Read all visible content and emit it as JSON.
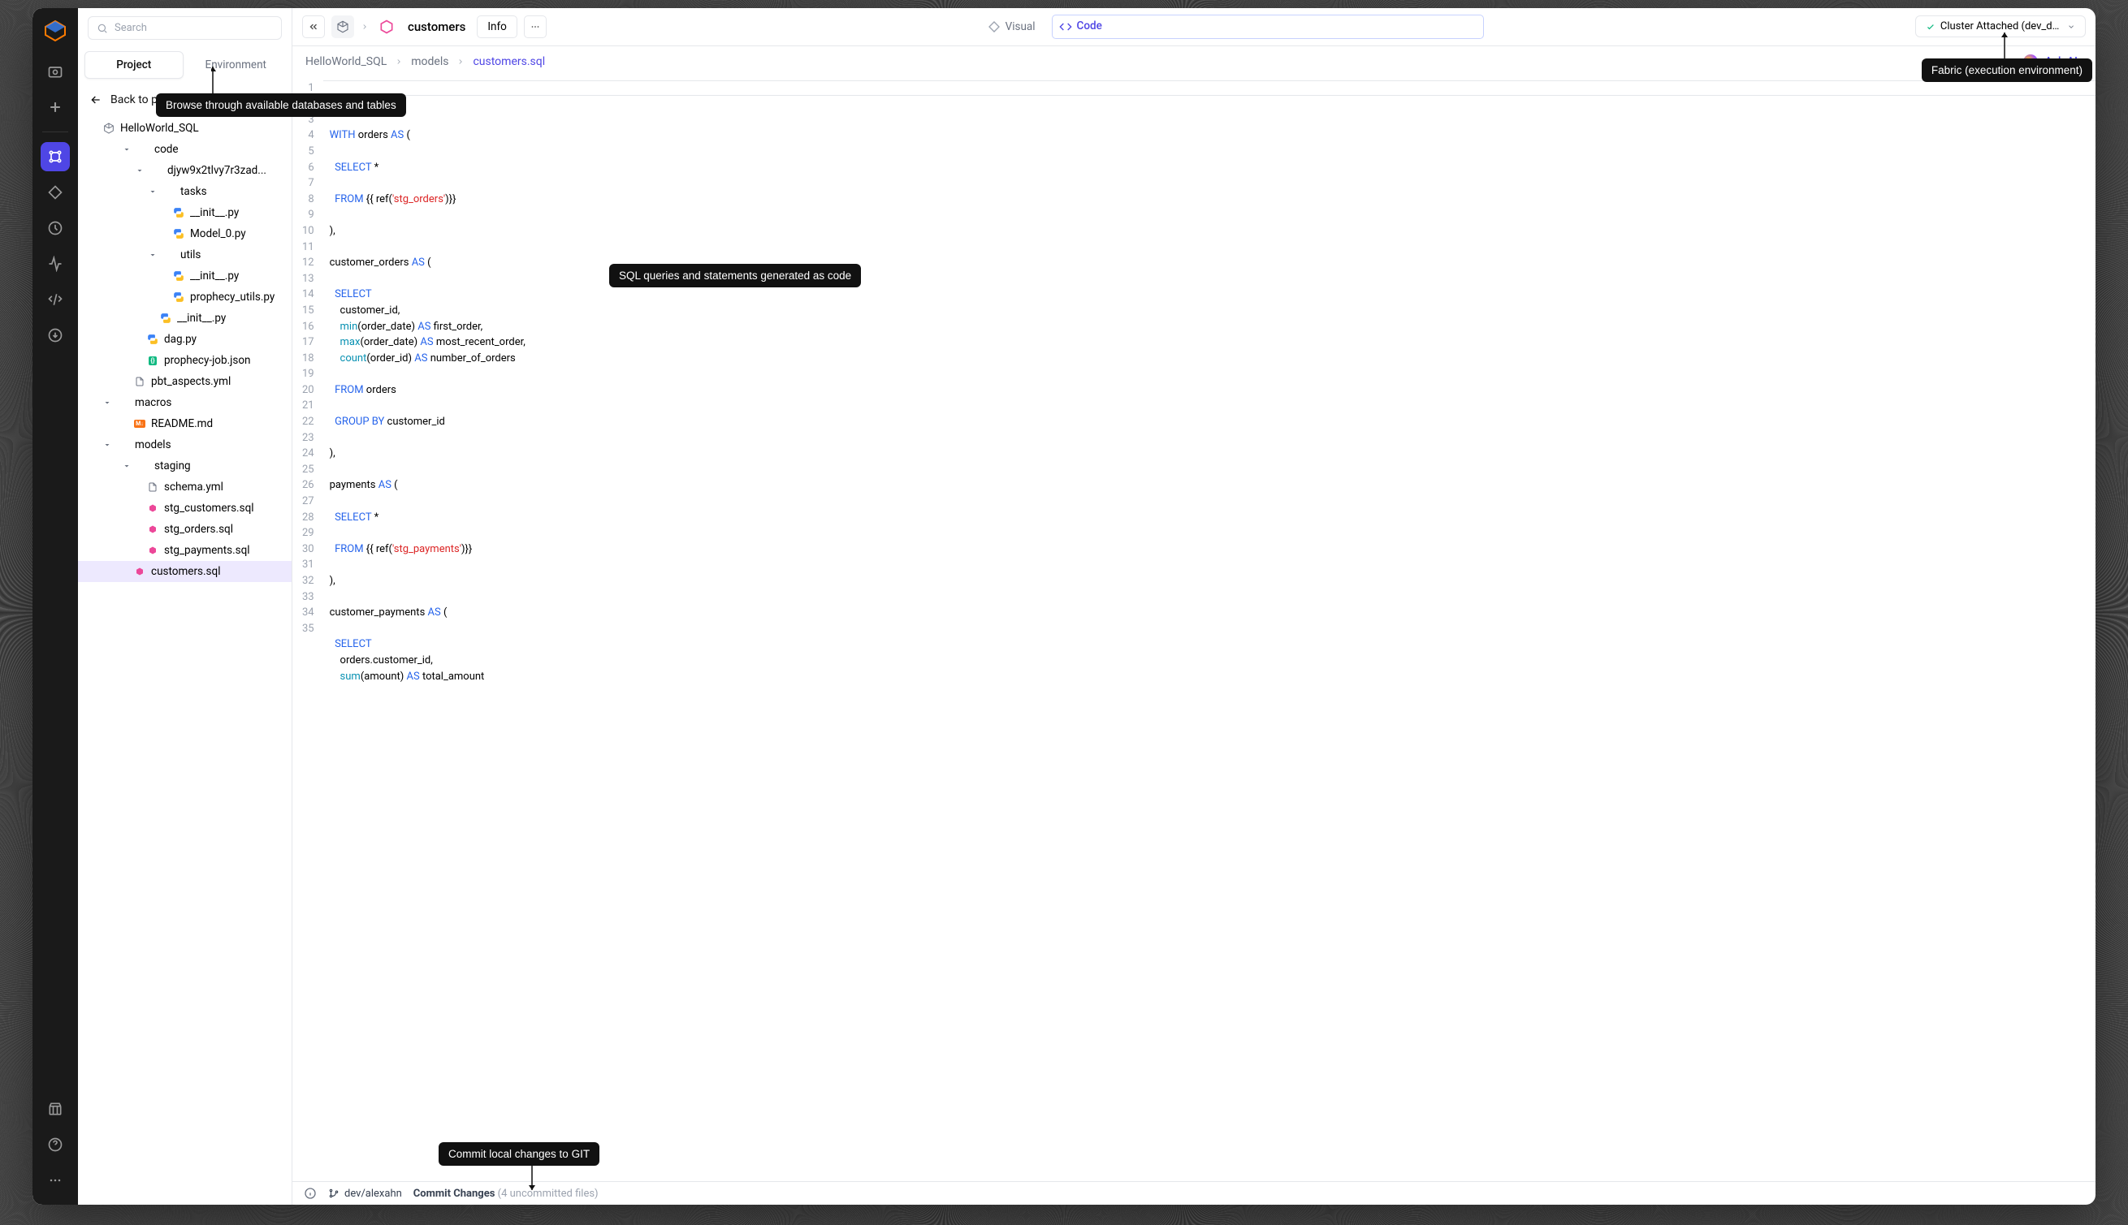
{
  "search": {
    "placeholder": "Search"
  },
  "sidebar_tabs": {
    "project": "Project",
    "environment": "Environment"
  },
  "back": "Back to project",
  "project_name": "HelloWorld_SQL",
  "tree": [
    {
      "depth": 0,
      "kind": "cube",
      "label": "HelloWorld_SQL",
      "chev": ""
    },
    {
      "depth": 1,
      "kind": "folder",
      "label": "code",
      "chev": "down"
    },
    {
      "depth": 2,
      "kind": "folder",
      "label": "djyw9x2tlvy7r3zad...",
      "chev": "down"
    },
    {
      "depth": 3,
      "kind": "folder",
      "label": "tasks",
      "chev": "down"
    },
    {
      "depth": 4,
      "kind": "py",
      "label": "__init__.py",
      "chev": ""
    },
    {
      "depth": 4,
      "kind": "py",
      "label": "Model_0.py",
      "chev": ""
    },
    {
      "depth": 3,
      "kind": "folder",
      "label": "utils",
      "chev": "down"
    },
    {
      "depth": 4,
      "kind": "py",
      "label": "__init__.py",
      "chev": ""
    },
    {
      "depth": 4,
      "kind": "py",
      "label": "prophecy_utils.py",
      "chev": ""
    },
    {
      "depth": 3,
      "kind": "py",
      "label": "__init__.py",
      "chev": ""
    },
    {
      "depth": 2,
      "kind": "py",
      "label": "dag.py",
      "chev": ""
    },
    {
      "depth": 2,
      "kind": "json",
      "label": "prophecy-job.json",
      "chev": ""
    },
    {
      "depth": 1,
      "kind": "yml",
      "label": "pbt_aspects.yml",
      "chev": ""
    },
    {
      "depth": 0,
      "kind": "folder",
      "label": "macros",
      "chev": "down"
    },
    {
      "depth": 1,
      "kind": "md",
      "label": "README.md",
      "chev": ""
    },
    {
      "depth": 0,
      "kind": "folder",
      "label": "models",
      "chev": "down"
    },
    {
      "depth": 1,
      "kind": "folder",
      "label": "staging",
      "chev": "down"
    },
    {
      "depth": 2,
      "kind": "yml",
      "label": "schema.yml",
      "chev": ""
    },
    {
      "depth": 2,
      "kind": "sql",
      "label": "stg_customers.sql",
      "chev": ""
    },
    {
      "depth": 2,
      "kind": "sql",
      "label": "stg_orders.sql",
      "chev": ""
    },
    {
      "depth": 2,
      "kind": "sql",
      "label": "stg_payments.sql",
      "chev": ""
    },
    {
      "depth": 1,
      "kind": "sql",
      "label": "customers.sql",
      "chev": "",
      "selected": true
    }
  ],
  "topbar": {
    "title": "customers",
    "info": "Info",
    "visual": "Visual",
    "code": "Code",
    "cluster": "Cluster Attached (dev_databr..."
  },
  "breadcrumbs": [
    "HelloWorld_SQL",
    "models",
    "customers.sql"
  ],
  "ask_ai": "Ask AI",
  "code_lines": [
    [
      {
        "t": "WITH ",
        "c": "kw"
      },
      {
        "t": "orders "
      },
      {
        "t": "AS ",
        "c": "kw"
      },
      {
        "t": "("
      }
    ],
    [],
    [
      {
        "t": "  "
      },
      {
        "t": "SELECT ",
        "c": "kw"
      },
      {
        "t": "*"
      }
    ],
    [],
    [
      {
        "t": "  "
      },
      {
        "t": "FROM ",
        "c": "kw"
      },
      {
        "t": "{{ ref("
      },
      {
        "t": "'stg_orders'",
        "c": "str"
      },
      {
        "t": ")}}"
      }
    ],
    [],
    [
      {
        "t": "),"
      }
    ],
    [],
    [
      {
        "t": "customer_orders "
      },
      {
        "t": "AS ",
        "c": "kw"
      },
      {
        "t": "("
      }
    ],
    [],
    [
      {
        "t": "  "
      },
      {
        "t": "SELECT",
        "c": "kw"
      }
    ],
    [
      {
        "t": "    customer_id,"
      }
    ],
    [
      {
        "t": "    "
      },
      {
        "t": "min",
        "c": "fn"
      },
      {
        "t": "(order_date) "
      },
      {
        "t": "AS ",
        "c": "kw"
      },
      {
        "t": "first_order,"
      }
    ],
    [
      {
        "t": "    "
      },
      {
        "t": "max",
        "c": "fn"
      },
      {
        "t": "(order_date) "
      },
      {
        "t": "AS ",
        "c": "kw"
      },
      {
        "t": "most_recent_order,"
      }
    ],
    [
      {
        "t": "    "
      },
      {
        "t": "count",
        "c": "fn"
      },
      {
        "t": "(order_id) "
      },
      {
        "t": "AS ",
        "c": "kw"
      },
      {
        "t": "number_of_orders"
      }
    ],
    [],
    [
      {
        "t": "  "
      },
      {
        "t": "FROM ",
        "c": "kw"
      },
      {
        "t": "orders"
      }
    ],
    [],
    [
      {
        "t": "  "
      },
      {
        "t": "GROUP BY ",
        "c": "kw"
      },
      {
        "t": "customer_id"
      }
    ],
    [],
    [
      {
        "t": "),"
      }
    ],
    [],
    [
      {
        "t": "payments "
      },
      {
        "t": "AS ",
        "c": "kw"
      },
      {
        "t": "("
      }
    ],
    [],
    [
      {
        "t": "  "
      },
      {
        "t": "SELECT ",
        "c": "kw"
      },
      {
        "t": "*"
      }
    ],
    [],
    [
      {
        "t": "  "
      },
      {
        "t": "FROM ",
        "c": "kw"
      },
      {
        "t": "{{ ref("
      },
      {
        "t": "'stg_payments'",
        "c": "str"
      },
      {
        "t": ")}}"
      }
    ],
    [],
    [
      {
        "t": "),"
      }
    ],
    [],
    [
      {
        "t": "customer_payments "
      },
      {
        "t": "AS ",
        "c": "kw"
      },
      {
        "t": "("
      }
    ],
    [],
    [
      {
        "t": "  "
      },
      {
        "t": "SELECT",
        "c": "kw"
      }
    ],
    [
      {
        "t": "    orders.customer_id,"
      }
    ],
    [
      {
        "t": "    "
      },
      {
        "t": "sum",
        "c": "fn"
      },
      {
        "t": "(amount) "
      },
      {
        "t": "AS ",
        "c": "kw"
      },
      {
        "t": "total_amount"
      }
    ]
  ],
  "statusbar": {
    "branch": "dev/alexahn",
    "commit": "Commit Changes",
    "uncommitted": "(4 uncommitted files)"
  },
  "callouts": {
    "env": "Browse through available databases and tables",
    "fabric": "Fabric (execution environment)",
    "sql": "SQL queries and statements generated as code",
    "commit": "Commit local changes to GIT"
  }
}
